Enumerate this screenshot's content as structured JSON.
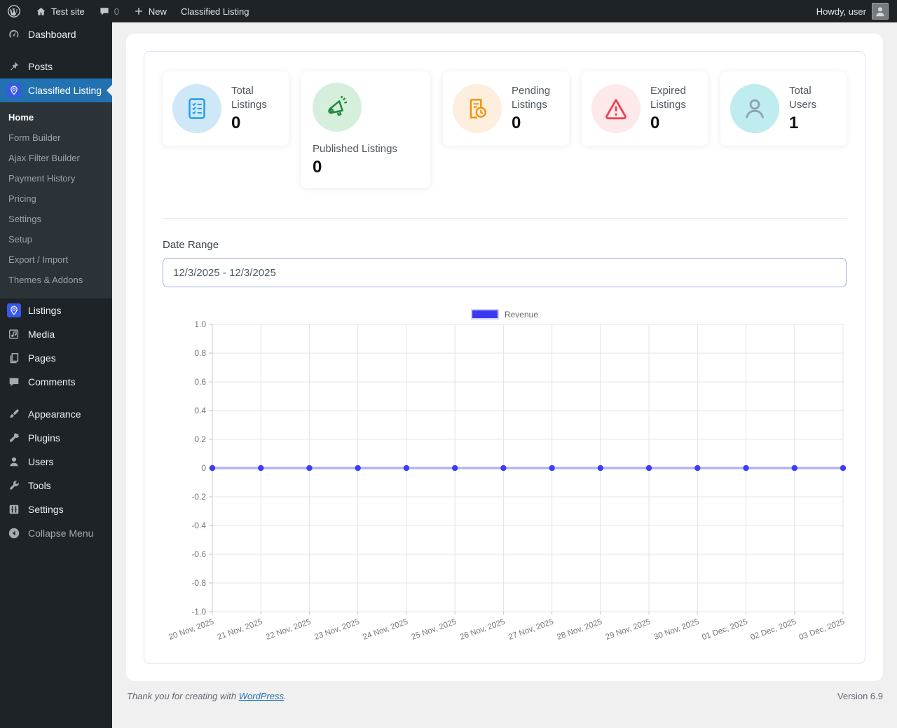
{
  "admin_bar": {
    "site_name": "Test site",
    "comment_count": "0",
    "new_label": "New",
    "current_page": "Classified Listing",
    "greeting": "Howdy, user"
  },
  "sidebar": {
    "dashboard": "Dashboard",
    "posts": "Posts",
    "classified": {
      "label": "Classified Listing",
      "submenu": [
        "Home",
        "Form Builder",
        "Ajax Filter Builder",
        "Payment History",
        "Pricing",
        "Settings",
        "Setup",
        "Export / Import",
        "Themes & Addons"
      ]
    },
    "listings": "Listings",
    "media": "Media",
    "pages": "Pages",
    "comments": "Comments",
    "appearance": "Appearance",
    "plugins": "Plugins",
    "users": "Users",
    "tools": "Tools",
    "settings": "Settings",
    "collapse": "Collapse Menu"
  },
  "stats": [
    {
      "label": "Total Listings",
      "value": "0",
      "icon": "checklist-icon",
      "circle": "#cfe8f8"
    },
    {
      "label": "Published Listings",
      "value": "0",
      "icon": "megaphone-icon",
      "circle": "#d6efdc"
    },
    {
      "label": "Pending Listings",
      "value": "0",
      "icon": "document-clock-icon",
      "circle": "#fdeedd"
    },
    {
      "label": "Expired Listings",
      "value": "0",
      "icon": "warning-icon",
      "circle": "#fde9ea"
    },
    {
      "label": "Total Users",
      "value": "1",
      "icon": "user-icon",
      "circle": "#bfecef"
    }
  ],
  "date_range": {
    "label": "Date Range",
    "value": "12/3/2025 - 12/3/2025"
  },
  "chart_data": {
    "type": "line",
    "title": "",
    "xlabel": "",
    "ylabel": "",
    "legend_position": "top-center",
    "grid": true,
    "ylim": [
      -1.0,
      1.0
    ],
    "yticks": [
      1.0,
      0.8,
      0.6,
      0.4,
      0.2,
      0,
      -0.2,
      -0.4,
      -0.6,
      -0.8,
      -1.0
    ],
    "x": [
      "20 Nov, 2025",
      "21 Nov, 2025",
      "22 Nov, 2025",
      "23 Nov, 2025",
      "24 Nov, 2025",
      "25 Nov, 2025",
      "26 Nov, 2025",
      "27 Nov, 2025",
      "28 Nov, 2025",
      "29 Nov, 2025",
      "30 Nov, 2025",
      "01 Dec, 2025",
      "02 Dec, 2025",
      "03 Dec, 2025"
    ],
    "series": [
      {
        "name": "Revenue",
        "values": [
          0,
          0,
          0,
          0,
          0,
          0,
          0,
          0,
          0,
          0,
          0,
          0,
          0,
          0
        ],
        "line_color": "#b3b3f7",
        "point_color": "#3d3df5",
        "legend_color": "#3a3af0"
      }
    ]
  },
  "footer": {
    "thanks": "Thank you for creating with",
    "link": "WordPress",
    "period": ".",
    "version": "Version 6.9"
  }
}
